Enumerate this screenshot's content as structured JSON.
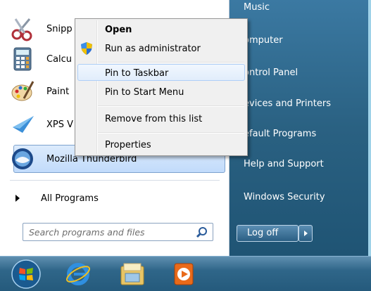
{
  "start_menu": {
    "programs": [
      {
        "label": "Snipp",
        "icon": "scissors-icon"
      },
      {
        "label": "Calcu",
        "icon": "calculator-icon"
      },
      {
        "label": "Paint",
        "icon": "paint-palette-icon"
      },
      {
        "label": "XPS V",
        "icon": "xps-viewer-icon"
      },
      {
        "label": "Mozilla Thunderbird",
        "icon": "thunderbird-icon"
      }
    ],
    "all_programs": "All Programs",
    "search_placeholder": "Search programs and files",
    "right_items": [
      "Music",
      "omputer",
      "ontrol Panel",
      "evices and Printers",
      "efault Programs",
      "Help and Support",
      "Windows Security"
    ],
    "log_off": "Log off"
  },
  "context_menu": {
    "items": [
      {
        "label": "Open",
        "bold": true
      },
      {
        "label": "Run as administrator",
        "icon": "uac-shield-icon"
      },
      {
        "label": "Pin to Taskbar",
        "highlighted": true
      },
      {
        "label": "Pin to Start Menu"
      },
      {
        "label": "Remove from this list"
      },
      {
        "label": "Properties"
      }
    ]
  },
  "taskbar": {
    "items": [
      "start-orb-icon",
      "internet-explorer-icon",
      "file-explorer-icon",
      "media-player-icon"
    ]
  },
  "colors": {
    "accent_highlight": "#c1dbfb",
    "right_pane": "#2a6182",
    "taskbar": "#2f6689"
  }
}
